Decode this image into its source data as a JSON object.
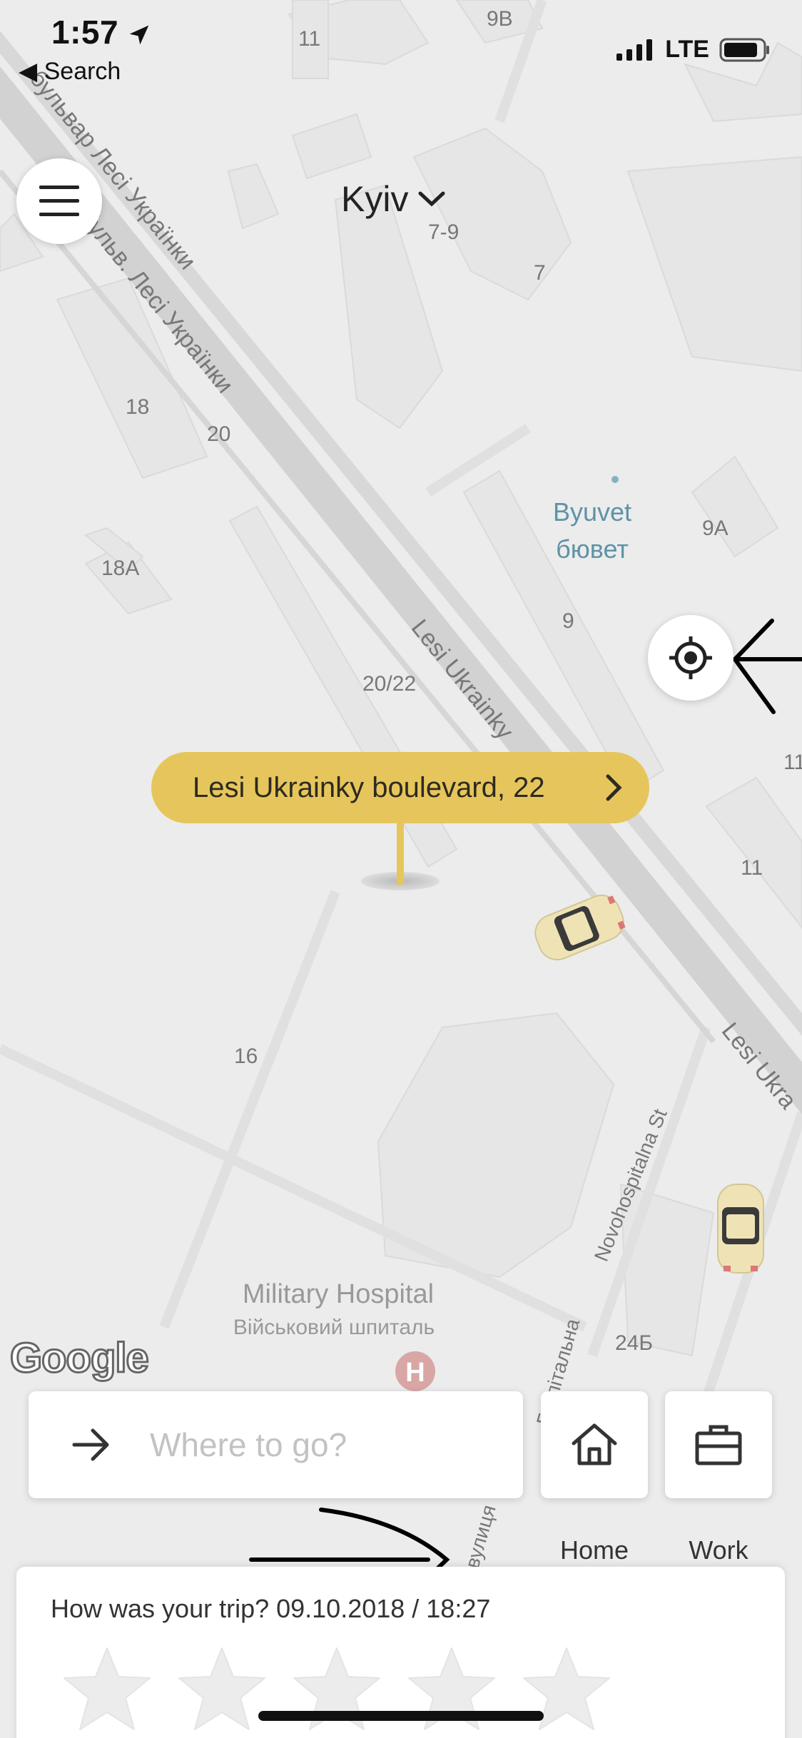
{
  "status_bar": {
    "time": "1:57",
    "back_label": "Search",
    "network": "LTE"
  },
  "header": {
    "city": "Kyiv"
  },
  "map": {
    "street_labels": [
      "бульвар Лесі Українки",
      "бульв. Лесі Українки",
      "Lesi Ukrainky",
      "Lesi Ukra",
      "Novohospitalna St",
      "Госпітальна",
      "вулиця"
    ],
    "building_numbers": [
      "11",
      "9B",
      "7-9",
      "7",
      "18",
      "20",
      "18A",
      "9A",
      "9",
      "20/22",
      "11",
      "11",
      "16",
      "24Б"
    ],
    "poi": {
      "name_en": "Byuvet",
      "name_uk": "бювет"
    },
    "hospital": {
      "name_en": "Military Hospital",
      "name_uk": "Військовий шпиталь",
      "icon_letter": "H"
    },
    "attribution": "Google"
  },
  "pickup": {
    "address": "Lesi Ukrainky boulevard, 22"
  },
  "destination": {
    "placeholder": "Where to go?"
  },
  "shortcuts": {
    "home_label": "Home",
    "work_label": "Work"
  },
  "rating": {
    "prompt": "How was your trip? 09.10.2018 / 18:27",
    "stars_max": 5,
    "stars_selected": 0
  },
  "colors": {
    "accent": "#e6c65c",
    "map_background": "#ececec",
    "road": "#d2d2d2",
    "poi_text": "#5e93a6"
  }
}
